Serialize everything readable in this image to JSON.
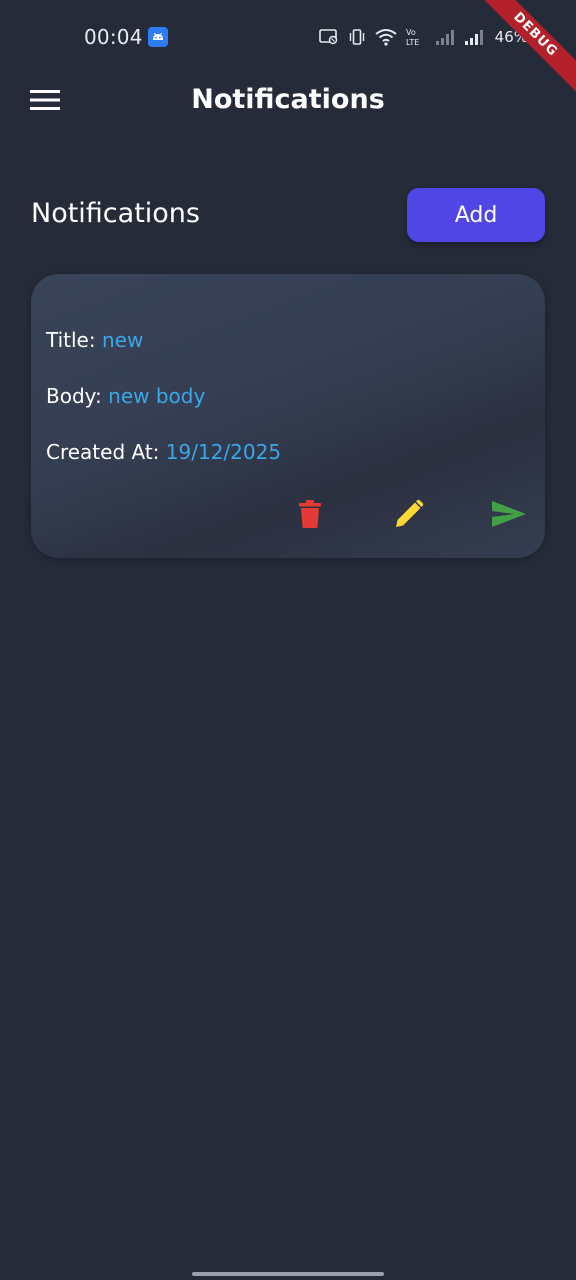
{
  "status_bar": {
    "time": "00:04",
    "battery": "46%",
    "icons": [
      "android-notification-icon",
      "cast-icon",
      "vibrate-icon",
      "wifi-icon",
      "volte-icon",
      "signal-icon",
      "signal-icon",
      "battery-icon"
    ]
  },
  "debug_ribbon": {
    "label": "DEBUG",
    "color": "#b3202a"
  },
  "app_bar": {
    "title": "Notifications",
    "menu_icon": "hamburger-menu-icon"
  },
  "section": {
    "title": "Notifications",
    "add_label": "Add",
    "add_color": "#4f46e5"
  },
  "notifications": [
    {
      "title_label": "Title:",
      "title": "new",
      "body_label": "Body:",
      "body": "new body",
      "created_label": "Created At:",
      "created_at": "19/12/2025",
      "actions": [
        {
          "icon": "trash-icon",
          "color": "#e53935"
        },
        {
          "icon": "pencil-icon",
          "color": "#fdd835"
        },
        {
          "icon": "send-icon",
          "color": "#43a047"
        }
      ]
    }
  ],
  "colors": {
    "background": "#262b3a",
    "value_text": "#3aa7e8"
  }
}
